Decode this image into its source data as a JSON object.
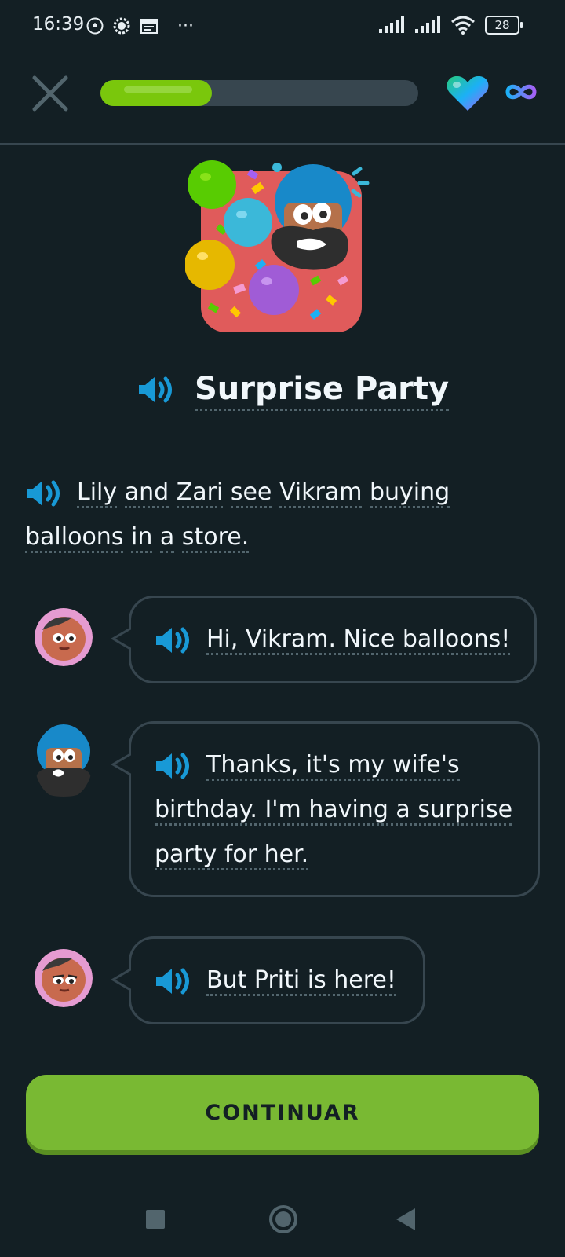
{
  "status_bar": {
    "time": "16:39",
    "ellipsis": "···",
    "battery": "28",
    "icons": [
      "soccer-ball-icon",
      "settings-notification-icon",
      "calendar-icon",
      "signal-icon",
      "signal-icon",
      "wifi-icon",
      "battery-icon"
    ]
  },
  "top_bar": {
    "close_icon": "close-icon",
    "progress": 0.35,
    "heart_icon": "super-heart-icon",
    "infinity_icon": "infinity-icon"
  },
  "story": {
    "title": "Surprise Party",
    "narration": [
      "Lily",
      "and",
      "Zari",
      "see",
      "Vikram",
      "buying",
      "balloons",
      "in",
      "a",
      "store."
    ],
    "messages": [
      {
        "speaker": "Lily",
        "text": "Hi, Vikram. Nice balloons!"
      },
      {
        "speaker": "Vikram",
        "lines": [
          "Thanks, it's my wife's",
          "birthday. I'm having a surprise",
          "party for her."
        ]
      },
      {
        "speaker": "Lily",
        "text": "But Priti is here!"
      }
    ]
  },
  "continue_label": "CONTINUAR",
  "nav_bar": {
    "icons": [
      "recents-square-icon",
      "home-circle-icon",
      "back-triangle-icon"
    ]
  },
  "colors": {
    "background": "#131f24",
    "accent_green": "#79b933",
    "speaker_blue": "#1cb0f6",
    "border": "#37464f"
  }
}
